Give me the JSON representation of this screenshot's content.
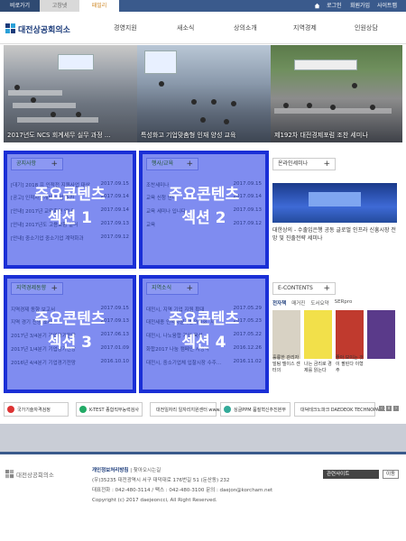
{
  "top_tabs": [
    "비로가기",
    "고창넷",
    "패밀리"
  ],
  "util_links": [
    "로그인",
    "회원가입",
    "사이트맵"
  ],
  "logo": {
    "text": "대전상공회의소"
  },
  "nav": [
    "경영지원",
    "새소식",
    "상의소개",
    "지역경제",
    "인원상담"
  ],
  "banner_captions": [
    "2017년도 NCS 회계세무 실무 과정 ...",
    "특성화고 기업맞춤형 인재 양성 교육",
    "제192차 대전경제포럼 조찬 세미나"
  ],
  "panels": [
    {
      "title": "공지사항",
      "overlay": [
        "주요콘텐츠",
        "섹션 1"
      ],
      "rows": [
        {
          "t": "[대기] 2018 프 인적전 지원사업 대상",
          "d": "2017.09.15"
        },
        {
          "t": "[공고] 인적자원개발 사업 추진",
          "d": "2017.09.14"
        },
        {
          "t": "[안내] 2017년 교육훈련 안내",
          "d": "2017.09.14"
        },
        {
          "t": "[안내] 2017년도 고용보험 일터",
          "d": "2017.09.13"
        },
        {
          "t": "[안내] 중소기업 중소기업 계약화과",
          "d": "2017.09.12"
        }
      ]
    },
    {
      "title": "행사/교육",
      "overlay": [
        "주요콘텐츠",
        "섹션 2"
      ],
      "rows": [
        {
          "t": "조찬세미나",
          "d": "2017.09.15"
        },
        {
          "t": "교육 신청 안내",
          "d": "2017.09.14"
        },
        {
          "t": "교육 세미나 입니다",
          "d": "2017.09.13"
        },
        {
          "t": "교육",
          "d": "2017.09.12"
        }
      ]
    },
    {
      "title": "지역경제동향",
      "overlay": [
        "주요콘텐츠",
        "섹션 3"
      ],
      "rows": [
        {
          "t": "지역경제 동향 보고서",
          "d": "2017.09.15"
        },
        {
          "t": "지역 경기 전망 조사",
          "d": "2017.09.13"
        },
        {
          "t": "2017년 3/4분기 기업경기전망",
          "d": "2017.06.13"
        },
        {
          "t": "2017년 1/4분기 기업경기전망",
          "d": "2017.01.09"
        },
        {
          "t": "2016년 4/4분기 기업경기전망",
          "d": "2016.10.10"
        }
      ]
    },
    {
      "title": "지역소식",
      "overlay": [
        "주요콘텐츠",
        "섹션 4"
      ],
      "rows": [
        {
          "t": "대전시, 지역 기업 지원 확대",
          "d": "2017.05.29"
        },
        {
          "t": "대전세종 인적자원개발위원회, 지...",
          "d": "2017.05.23"
        },
        {
          "t": "대전시, 나노융합 기업 육성...",
          "d": "2017.05.22"
        },
        {
          "t": "화합2017 나눔 캠페인 시상식",
          "d": "2016.12.26"
        },
        {
          "t": "대전시, 중소기업체 입찰시장 수주...",
          "d": "2016.11.02"
        }
      ]
    }
  ],
  "online_seminar": {
    "title": "온라인세미나",
    "caption": "대한상의 - 수출입은행 공동 글로벌 인프라 신흥시장 전망 및 진출전략 세미나"
  },
  "econtents": {
    "title": "E-CONTENTS",
    "tabs": [
      "전자책",
      "매거진",
      "도서요약",
      "SERpro"
    ],
    "books": [
      {
        "title": "훌륭한 관리자 빌팀 델이스 센터의",
        "color": "#d8d2c4"
      },
      {
        "title": "나는 금리로 경제를 읽는다",
        "color": "#f2e04a"
      },
      {
        "title": "좋아 보이는 것이 팔린다 이형주",
        "color": "#c03a2e"
      },
      {
        "title": "",
        "color": "#5a3a8a"
      }
    ]
  },
  "partners": [
    {
      "name": "국가기술자격검정",
      "color": "#d33"
    },
    {
      "name": "K-TEST 종합직무능력검사",
      "color": "#2a6"
    },
    {
      "name": "대전일자리 일자리지원센터 www.job114.or.kr",
      "color": "#36c"
    },
    {
      "name": "싱글PPM 품질혁신추진본부",
      "color": "#3a9"
    },
    {
      "name": "대덕테크노파크 DAEDEOK TECHNOPARK",
      "color": "#c22"
    }
  ],
  "footer": {
    "logo_text": "대전상공회의소",
    "policy": "개인정보처리방침",
    "email_reject": " | 찾아오시는길",
    "address": "(우)35235 대전광역시 서구 대덕대로 176번길 51 (둔산동) 232",
    "contact": "대표전화 : 042-480-3114 / 팩스 : 042-480-3100 문의 : daejon@korcham.net",
    "copyright": "Copyright (c) 2017 daejeoncci, All Right Reserved.",
    "related_label": "관련사이트",
    "go_label": "이동"
  }
}
